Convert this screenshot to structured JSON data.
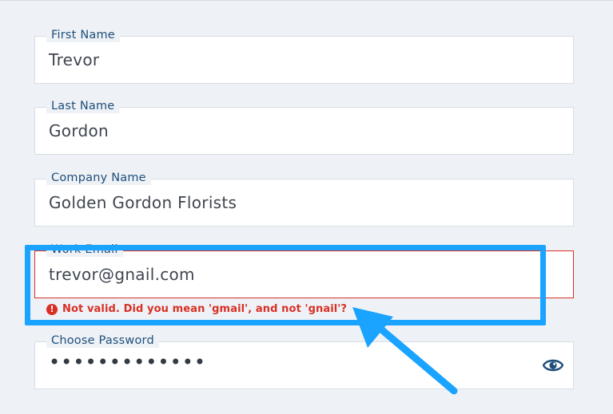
{
  "form": {
    "first_name": {
      "label": "First Name",
      "value": "Trevor"
    },
    "last_name": {
      "label": "Last Name",
      "value": "Gordon"
    },
    "company_name": {
      "label": "Company Name",
      "value": "Golden Gordon Florists"
    },
    "work_email": {
      "label": "Work Email",
      "value": "trevor@gnail.com",
      "error": "Not valid. Did you mean 'gmail', and not 'gnail'?",
      "error_icon": "!"
    },
    "password": {
      "label": "Choose Password",
      "value": "•••••••••••••",
      "toggle_icon": "eye-icon"
    }
  },
  "annotation": {
    "highlight_color": "#1aa3ff",
    "arrow_color": "#1aa3ff"
  },
  "colors": {
    "label": "#1f4e7a",
    "error": "#d93025",
    "background": "#eef2f7"
  }
}
